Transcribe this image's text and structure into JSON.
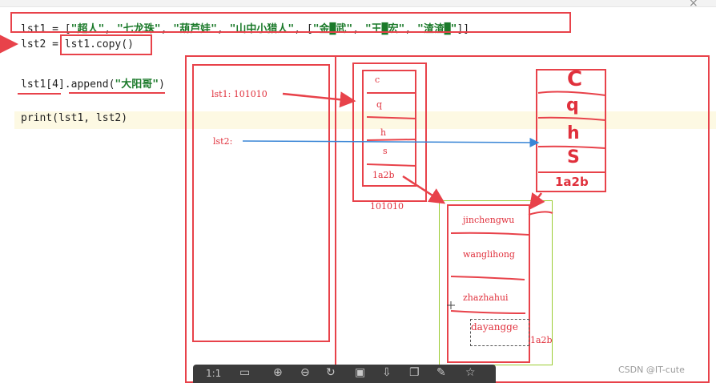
{
  "code": {
    "line1_prefix": "lst1 = [",
    "line1_items": [
      "\"超人\"",
      "\"七龙珠\"",
      "\"葫芦娃\"",
      "\"山中小猎人\""
    ],
    "line1_inner_open": "[",
    "line1_inner_items": [
      "\"金█武\"",
      "\"王█宏\"",
      "\"渣渣█\""
    ],
    "line1_suffix": "]]",
    "line2_prefix": "lst2 = ",
    "line2_call": "lst1.copy()",
    "line3_target": "lst1[4]",
    "line3_method": ".append(",
    "line3_arg": "\"大阳哥\"",
    "line3_close": ")",
    "line4": "print(lst1, lst2)"
  },
  "diagram": {
    "lst1_label": "lst1: 101010",
    "lst2_label": "lst2:",
    "list1_items": [
      "c",
      "q",
      "h",
      "s",
      "1a2b"
    ],
    "list1_address": "101010",
    "list2_items": [
      "C",
      "q",
      "h",
      "S",
      "1a2b"
    ],
    "inner_items": [
      "jinchengwu",
      "wanglihong",
      "zhazhahui",
      "dayangge"
    ],
    "inner_address": "1a2b"
  },
  "colors": {
    "annotation_red": "#e8424a",
    "pointer_blue": "#3a86d6",
    "highlight_green": "#9bcc33",
    "string_green": "#1b7a2a"
  },
  "toolbar": {
    "zoom_label": "1:1",
    "icons": [
      "fit-screen-icon",
      "zoom-in-icon",
      "zoom-out-icon",
      "rotate-icon",
      "save-icon",
      "download-icon",
      "copy-icon",
      "edit-icon",
      "pin-icon"
    ]
  },
  "watermark": "CSDN @IT-cute"
}
